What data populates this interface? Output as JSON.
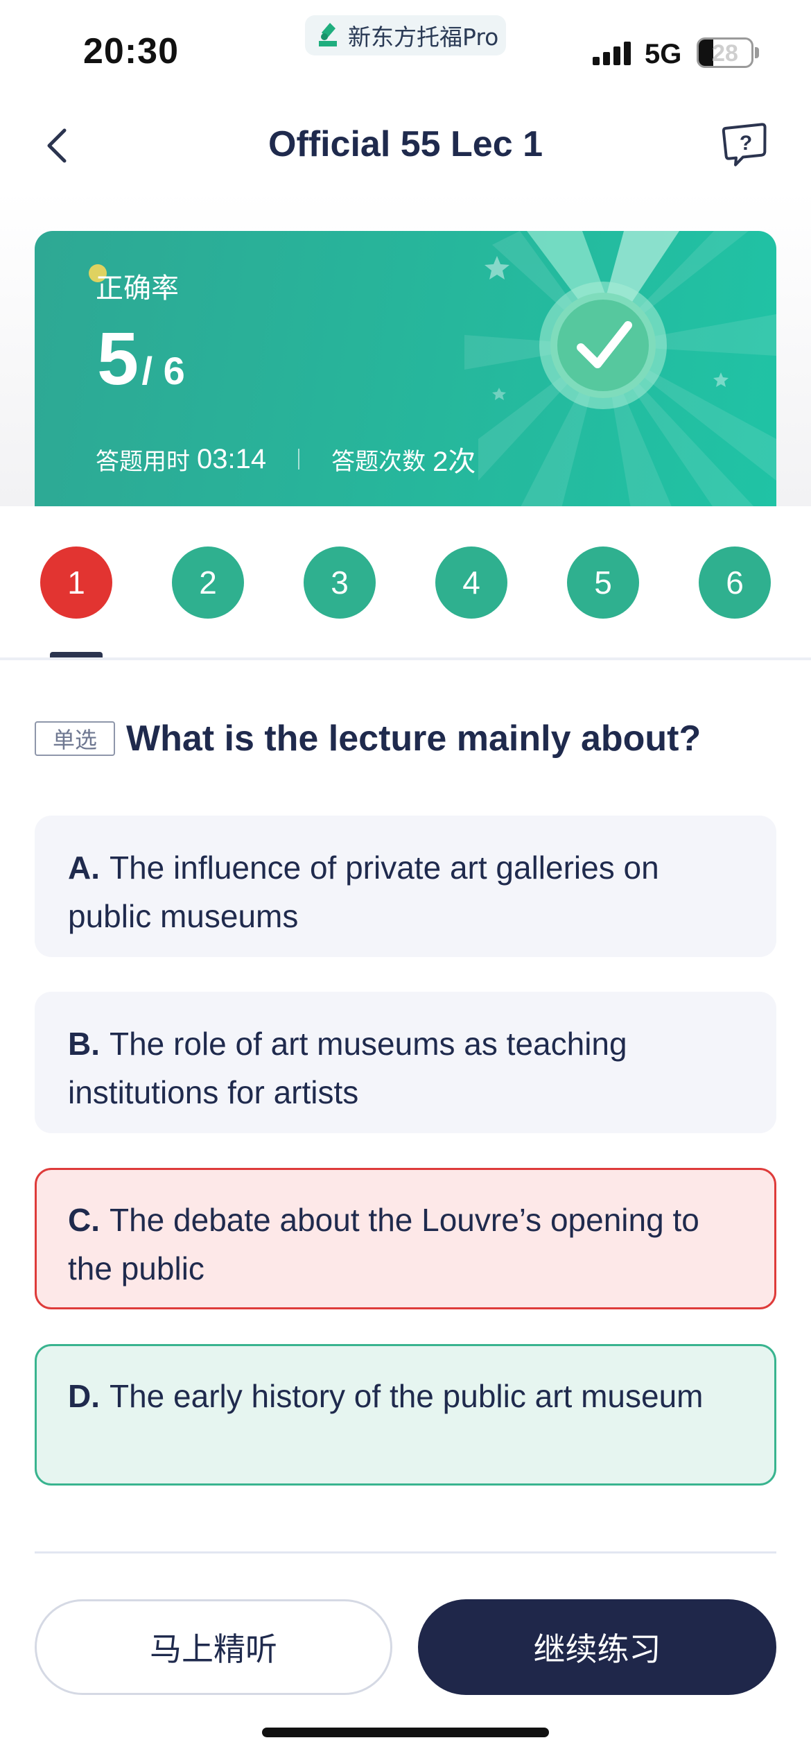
{
  "status_bar": {
    "time": "20:30",
    "app_name": "新东方托福Pro",
    "network": "5G",
    "battery": "28",
    "battery_level": 0.28
  },
  "nav": {
    "title": "Official 55 Lec 1",
    "back_icon": "chevron-left-icon",
    "help_icon": "question-bubble-icon"
  },
  "score": {
    "label": "正确率",
    "correct": "5",
    "total": "/ 6",
    "time_label": "答题用时",
    "time_value": "03:14",
    "attempts_label": "答题次数",
    "attempts_value": "2次",
    "medal_icon": "checkmark-medal-icon",
    "card_color": "#26b79c"
  },
  "question_nav": {
    "items": [
      {
        "label": "1",
        "status": "wrong"
      },
      {
        "label": "2",
        "status": "correct"
      },
      {
        "label": "3",
        "status": "correct"
      },
      {
        "label": "4",
        "status": "correct"
      },
      {
        "label": "5",
        "status": "correct"
      },
      {
        "label": "6",
        "status": "correct"
      }
    ],
    "selected_index": 0
  },
  "question": {
    "type_tag": "单选",
    "text": "What is the lecture mainly about?",
    "options": [
      {
        "letter": "A.",
        "text": "The influence of private art galleries on public museums",
        "state": "default"
      },
      {
        "letter": "B.",
        "text": "The role of art museums as teaching institutions for artists",
        "state": "default"
      },
      {
        "letter": "C.",
        "text": "The debate about the Louvre’s opening to the public",
        "state": "wrong"
      },
      {
        "letter": "D.",
        "text": "The early history of the public art museum",
        "state": "correct"
      }
    ]
  },
  "actions": {
    "listen_label": "马上精听",
    "continue_label": "继续练习"
  },
  "colors": {
    "correct": "#2fb08f",
    "wrong": "#e23431",
    "primary_dark": "#1f274a"
  }
}
